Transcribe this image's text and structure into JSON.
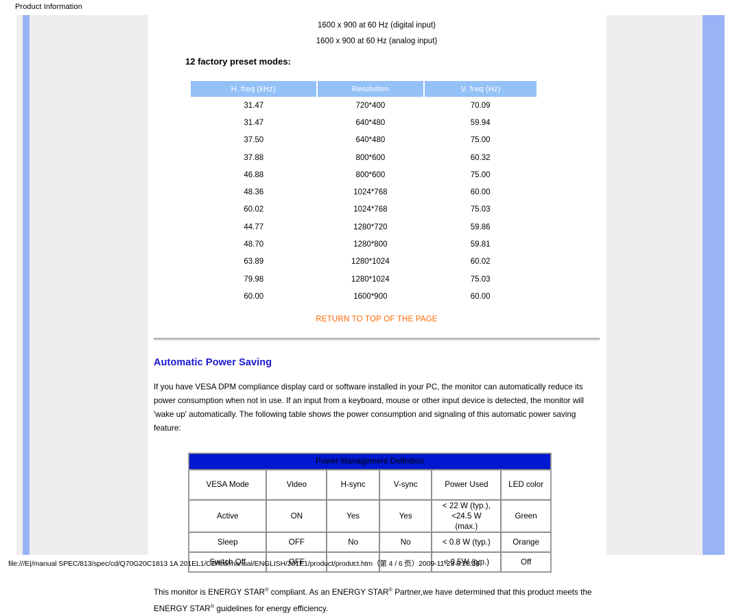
{
  "print_header": {
    "title": "Product Information"
  },
  "print_footer": {
    "text": "file:///E|/manual SPEC/813/spec/cd/Q70G20C1813 1A 201EL1/CD/lcd/manual/ENGLISH/201E1/product/product.htm（第 4 / 6 页）2009-11-23 8:23:16"
  },
  "colors": {
    "rail_blue": "#99b3f7",
    "rail_gray": "#eeeeee",
    "preset_header_blue": "#94c1f7",
    "heading_blue": "#1818d0",
    "link_orange": "#ff6600",
    "pm_title_blue": "#0018cf"
  },
  "main": {
    "mode_lines": [
      "1600 x 900 at 60 Hz (digital input)",
      "1600 x 900 at 60 Hz (analog input)"
    ],
    "preset_modes_heading": "12 factory preset modes:",
    "preset_table": {
      "columns": [
        "H. freq (kHz)",
        "Resolution",
        "V. freq (Hz)"
      ],
      "rows": [
        [
          "31.47",
          "720*400",
          "70.09"
        ],
        [
          "31.47",
          "640*480",
          "59.94"
        ],
        [
          "37.50",
          "640*480",
          "75.00"
        ],
        [
          "37.88",
          "800*600",
          "60.32"
        ],
        [
          "46.88",
          "800*600",
          "75.00"
        ],
        [
          "48.36",
          "1024*768",
          "60.00"
        ],
        [
          "60.02",
          "1024*768",
          "75.03"
        ],
        [
          "44.77",
          "1280*720",
          "59.86"
        ],
        [
          "48.70",
          "1280*800",
          "59.81"
        ],
        [
          "63.89",
          "1280*1024",
          "60.02"
        ],
        [
          "79.98",
          "1280*1024",
          "75.03"
        ],
        [
          "60.00",
          "1600*900",
          "60.00"
        ]
      ]
    },
    "return_to_top": "RETURN TO TOP OF THE PAGE",
    "power_saving": {
      "heading": "Automatic Power Saving",
      "paragraph": "If you have VESA DPM compliance display card or software installed in your PC, the monitor can automatically reduce its power consumption when not in use. If an input from a keyboard, mouse or other input device is detected, the monitor will 'wake up' automatically. The following table shows the power consumption and signaling of this automatic power saving feature:",
      "table": {
        "title": "Power Management Definition",
        "columns": [
          "VESA Mode",
          "Video",
          "H-sync",
          "V-sync",
          "Power Used",
          "LED color"
        ],
        "rows": [
          [
            "Active",
            "ON",
            "Yes",
            "Yes",
            "< 22 W (typ.), <24.5 W (max.)",
            "Green"
          ],
          [
            "Sleep",
            "OFF",
            "No",
            "No",
            "< 0.8 W (typ.)",
            "Orange"
          ],
          [
            "Switch Off",
            "OFF",
            "-",
            "-",
            "< 0.5W (typ.)",
            "Off"
          ]
        ],
        "power_used_active_line1": "< 22 W (typ.), <24.5 W",
        "power_used_active_line2": "(max.)"
      },
      "energy_star": {
        "line1_a": "This monitor is ENERGY STAR",
        "line1_sup1": "®",
        "line1_b": " compliant. As an ENERGY STAR",
        "line1_sup2": "®",
        "line1_c": " Partner,we have determined that this",
        "line2_a": "product meets the ENERGY STAR",
        "line2_sup": "®",
        "line2_b": " guidelines for energy efficiency."
      }
    }
  }
}
